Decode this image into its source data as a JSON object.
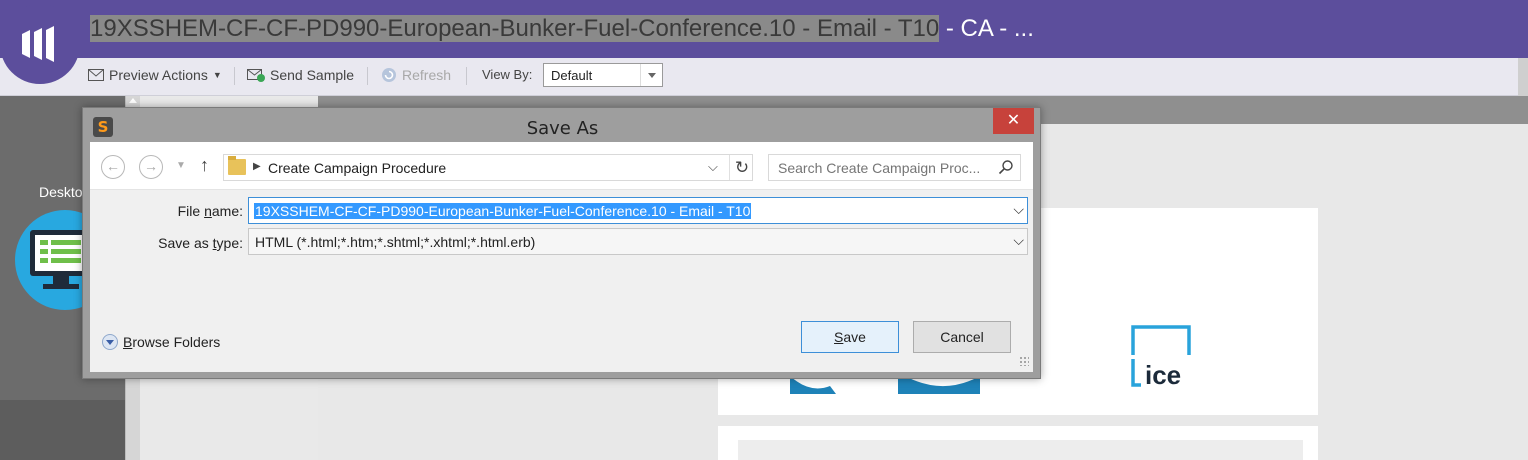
{
  "header": {
    "title_selected": "19XSSHEM-CF-CF-PD990-European-Bunker-Fuel-Conference.10 - Email - T10",
    "title_rest": " - CA - ...",
    "accent_color": "#5c4e9c"
  },
  "toolbar": {
    "preview_actions": "Preview Actions",
    "send_sample": "Send Sample",
    "refresh": "Refresh",
    "view_by_label": "View By:",
    "view_by_value": "Default"
  },
  "left_panel": {
    "desktop_label": "Desktop"
  },
  "preview": {
    "logo_text": "ice"
  },
  "dialog": {
    "app_icon": "S",
    "title": "Save As",
    "close_glyph": "✕",
    "nav": {
      "back_glyph": "←",
      "forward_glyph": "→",
      "up_glyph": "↑",
      "address_path": "Create Campaign Procedure",
      "refresh_glyph": "↻",
      "search_placeholder": "Search Create Campaign Proc..."
    },
    "file_name_label_pre": "File ",
    "file_name_label_u": "n",
    "file_name_label_post": "ame:",
    "file_name_value": "19XSSHEM-CF-CF-PD990-European-Bunker-Fuel-Conference.10 - Email - T10",
    "save_type_label_pre": "Save as ",
    "save_type_label_u": "t",
    "save_type_label_post": "ype:",
    "save_type_value": "HTML (*.html;*.htm;*.shtml;*.xhtml;*.html.erb)",
    "browse_folders_u": "B",
    "browse_folders_rest": "rowse Folders",
    "save_u": "S",
    "save_rest": "ave",
    "cancel": "Cancel"
  },
  "icons": [
    "marketo-logo-icon",
    "envelope-icon",
    "send-sample-icon",
    "refresh-icon",
    "desktop-monitor-icon",
    "folder-icon",
    "search-icon",
    "ice-logo-icon"
  ]
}
